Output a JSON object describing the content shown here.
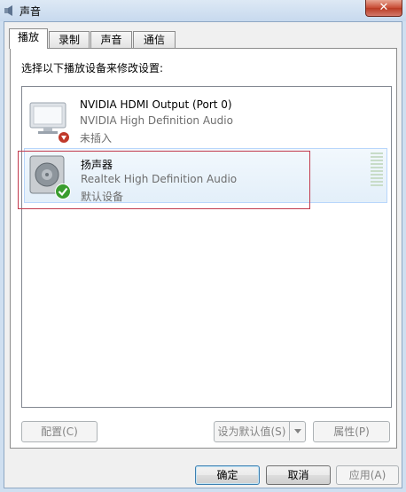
{
  "window": {
    "title": "声音",
    "close_symbol": "✕"
  },
  "tabs": [
    {
      "label": "播放",
      "active": true
    },
    {
      "label": "录制",
      "active": false
    },
    {
      "label": "声音",
      "active": false
    },
    {
      "label": "通信",
      "active": false
    }
  ],
  "main": {
    "instruction": "选择以下播放设备来修改设置:",
    "devices": [
      {
        "name": "NVIDIA HDMI Output (Port 0)",
        "description": "NVIDIA High Definition Audio",
        "status": "未插入",
        "icon": "monitor-icon",
        "badge": "unplugged-badge-icon",
        "selected": false
      },
      {
        "name": "扬声器",
        "description": "Realtek High Definition Audio",
        "status": "默认设备",
        "icon": "speaker-icon",
        "badge": "default-check-icon",
        "selected": true
      }
    ],
    "configure_button": "配置(C)",
    "set_default_button": "设为默认值(S)",
    "properties_button": "属性(P)"
  },
  "footer": {
    "ok_button": "确定",
    "cancel_button": "取消",
    "apply_button": "应用(A)"
  },
  "colors": {
    "selection_border": "#b8d6fb",
    "highlight_outline": "#c23a4d",
    "default_badge": "#3a9d2f",
    "unplugged_badge": "#c0392b"
  }
}
